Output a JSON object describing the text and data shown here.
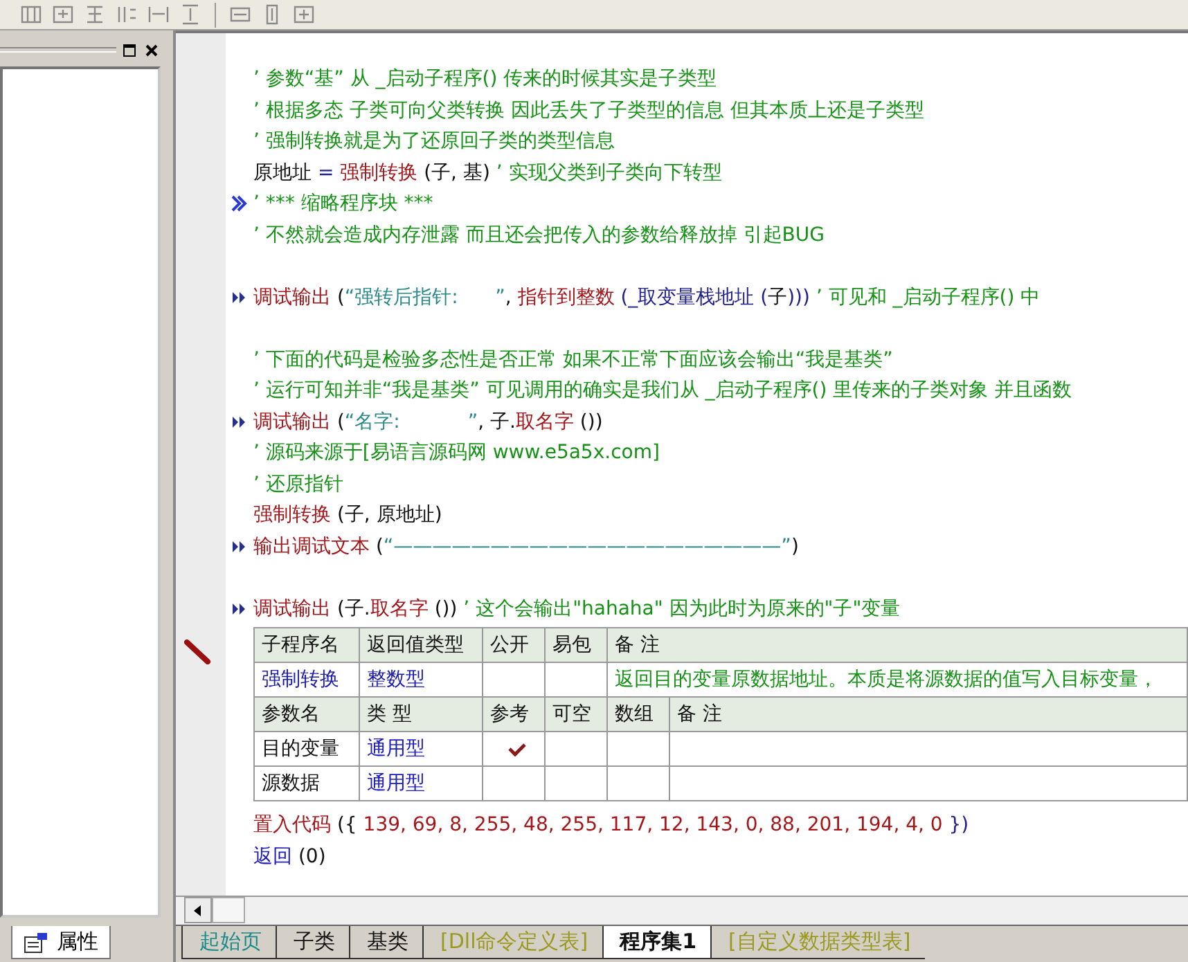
{
  "sidebar": {
    "bottom_tab": {
      "label": "属性",
      "selected": true
    }
  },
  "code_lines": [
    {
      "kind": "plain",
      "segments": [
        {
          "kind": "comment",
          "text": "’ 参数“基” 从 _启动子程序() 传来的时候其实是子类型"
        }
      ]
    },
    {
      "kind": "plain",
      "segments": [
        {
          "kind": "comment",
          "text": "’ 根据多态 子类可向父类转换 因此丢失了子类型的信息 但其本质上还是子类型"
        }
      ]
    },
    {
      "kind": "plain",
      "segments": [
        {
          "kind": "comment",
          "text": "’ 强制转换就是为了还原回子类的类型信息"
        }
      ]
    },
    {
      "kind": "plain",
      "segments": [
        {
          "kind": "text",
          "text": "原地址 "
        },
        {
          "kind": "operator",
          "text": "="
        },
        {
          "kind": "command",
          "text": " 强制转换"
        },
        {
          "kind": "text",
          "text": " (子, 基) "
        },
        {
          "kind": "comment",
          "text": "’ 实现父类到子类向下转型"
        }
      ]
    },
    {
      "kind": "folded",
      "segments": [
        {
          "kind": "comment",
          "text": "’ *** 缩略程序块 ***"
        }
      ]
    },
    {
      "kind": "plain",
      "segments": [
        {
          "kind": "comment",
          "text": "’ 不然就会造成内存泄露 而且还会把传入的参数给释放掉 引起BUG"
        }
      ]
    },
    {
      "kind": "blank"
    },
    {
      "kind": "command",
      "segments": [
        {
          "kind": "command",
          "text": "调试输出"
        },
        {
          "kind": "text",
          "text": " ("
        },
        {
          "kind": "string",
          "text": "“强转后指针:      ”"
        },
        {
          "kind": "text",
          "text": ", "
        },
        {
          "kind": "command",
          "text": "指针到整数"
        },
        {
          "kind": "operator",
          "text": " (_取变量栈地址 ("
        },
        {
          "kind": "text",
          "text": "子"
        },
        {
          "kind": "operator",
          "text": "))) "
        },
        {
          "kind": "comment",
          "text": "’ 可见和 _启动子程序() 中"
        }
      ]
    },
    {
      "kind": "blank"
    },
    {
      "kind": "plain",
      "segments": [
        {
          "kind": "comment",
          "text": "’ 下面的代码是检验多态性是否正常 如果不正常下面应该会输出“我是基类”"
        }
      ]
    },
    {
      "kind": "plain",
      "segments": [
        {
          "kind": "comment",
          "text": "’ 运行可知并非“我是基类” 可见调用的确实是我们从 _启动子程序() 里传来的子类对象 并且函数"
        }
      ]
    },
    {
      "kind": "command",
      "segments": [
        {
          "kind": "command",
          "text": "调试输出"
        },
        {
          "kind": "text",
          "text": " ("
        },
        {
          "kind": "string",
          "text": "“名字:           ”"
        },
        {
          "kind": "text",
          "text": ", 子."
        },
        {
          "kind": "command",
          "text": "取名字"
        },
        {
          "kind": "text",
          "text": " ())"
        }
      ]
    },
    {
      "kind": "plain",
      "segments": [
        {
          "kind": "comment",
          "text": "’ 源码来源于[易语言源码网 www.e5a5x.com]"
        }
      ]
    },
    {
      "kind": "plain",
      "segments": [
        {
          "kind": "comment",
          "text": "’ 还原指针"
        }
      ]
    },
    {
      "kind": "plain",
      "segments": [
        {
          "kind": "command",
          "text": "强制转换"
        },
        {
          "kind": "text",
          "text": " (子, 原地址)"
        }
      ]
    },
    {
      "kind": "command",
      "segments": [
        {
          "kind": "command",
          "text": "输出调试文本"
        },
        {
          "kind": "text",
          "text": " ("
        },
        {
          "kind": "string",
          "text": "“————————————————————”"
        },
        {
          "kind": "text",
          "text": ")"
        }
      ]
    },
    {
      "kind": "blank"
    },
    {
      "kind": "command",
      "segments": [
        {
          "kind": "command",
          "text": "调试输出"
        },
        {
          "kind": "text",
          "text": " (子."
        },
        {
          "kind": "command",
          "text": "取名字"
        },
        {
          "kind": "text",
          "text": " ()) "
        },
        {
          "kind": "comment",
          "text": "’ 这个会输出\"hahaha\" 因为此时为原来的\"子\"变量"
        }
      ]
    }
  ],
  "subroutine_table": {
    "header": [
      "子程序名",
      "返回值类型",
      "公开",
      "易包",
      "备 注"
    ],
    "subroutine": {
      "name": "强制转换",
      "return_type": "整数型",
      "public": false,
      "easy_package": false,
      "note": "返回目的变量原数据地址。本质是将源数据的值写入目标变量，"
    },
    "param_header": [
      "参数名",
      "类 型",
      "参考",
      "可空",
      "数组",
      "备 注"
    ],
    "params": [
      {
        "name": "目的变量",
        "type": "通用型",
        "reference": true,
        "nullable": false,
        "array": false
      },
      {
        "name": "源数据",
        "type": "通用型",
        "reference": false,
        "nullable": false,
        "array": false
      }
    ]
  },
  "tail_lines": [
    {
      "segments": [
        {
          "kind": "command",
          "text": "置入代码"
        },
        {
          "kind": "text",
          "text": " ({ "
        },
        {
          "kind": "number",
          "text": "139, 69, 8, 255, 48, 255, 117, 12, 143, 0, 88, 201, 194, 4, 0"
        },
        {
          "kind": "operator",
          "text": " })"
        }
      ]
    },
    {
      "segments": [
        {
          "kind": "keyword",
          "text": "返回"
        },
        {
          "kind": "text",
          "text": " (0)"
        }
      ]
    }
  ],
  "bottom_tabs": [
    {
      "label": "起始页",
      "kind": "page",
      "selected": false
    },
    {
      "label": "子类",
      "kind": "class",
      "selected": false
    },
    {
      "label": "基类",
      "kind": "class",
      "selected": false
    },
    {
      "label": "[Dll命令定义表]",
      "kind": "table",
      "selected": false
    },
    {
      "label": "程序集1",
      "kind": "class",
      "selected": true
    },
    {
      "label": "[自定义数据类型表]",
      "kind": "table",
      "selected": false
    }
  ]
}
